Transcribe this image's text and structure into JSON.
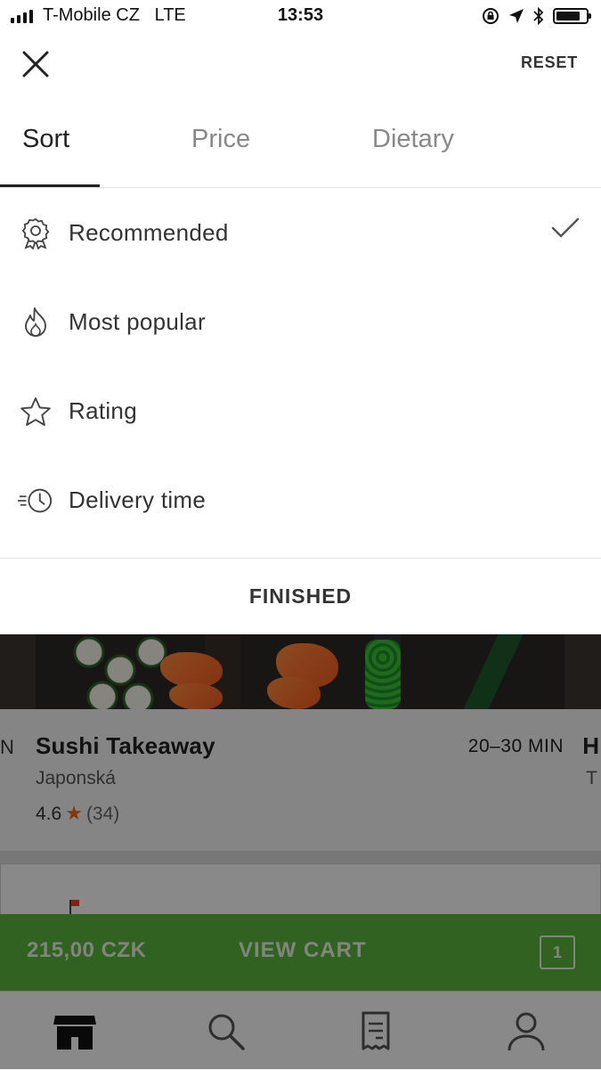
{
  "status_bar": {
    "carrier": "T-Mobile CZ",
    "network": "LTE",
    "time": "13:53"
  },
  "header": {
    "close_icon": "close-icon",
    "reset_label": "RESET"
  },
  "tabs": [
    {
      "label": "Sort",
      "active": true
    },
    {
      "label": "Price",
      "active": false
    },
    {
      "label": "Dietary",
      "active": false
    }
  ],
  "sort_options": [
    {
      "label": "Recommended",
      "icon": "award-icon",
      "selected": true
    },
    {
      "label": "Most popular",
      "icon": "flame-icon",
      "selected": false
    },
    {
      "label": "Rating",
      "icon": "star-icon",
      "selected": false
    },
    {
      "label": "Delivery time",
      "icon": "fast-clock-icon",
      "selected": false
    }
  ],
  "finish_label": "FINISHED",
  "background": {
    "restaurant": {
      "name": "Sushi Takeaway",
      "eta": "20–30 MIN",
      "cuisine": "Japonská",
      "rating": "4.6",
      "rating_count": "(34)"
    },
    "edge_left_text": "N",
    "edge_right_text": "H",
    "edge_right_sub": "T",
    "cart": {
      "total": "215,00 CZK",
      "view_label": "VIEW CART",
      "count": "1",
      "color": "#5ab23c"
    },
    "bottom_tabs": [
      "store-icon",
      "search-icon",
      "receipt-icon",
      "profile-icon"
    ]
  }
}
